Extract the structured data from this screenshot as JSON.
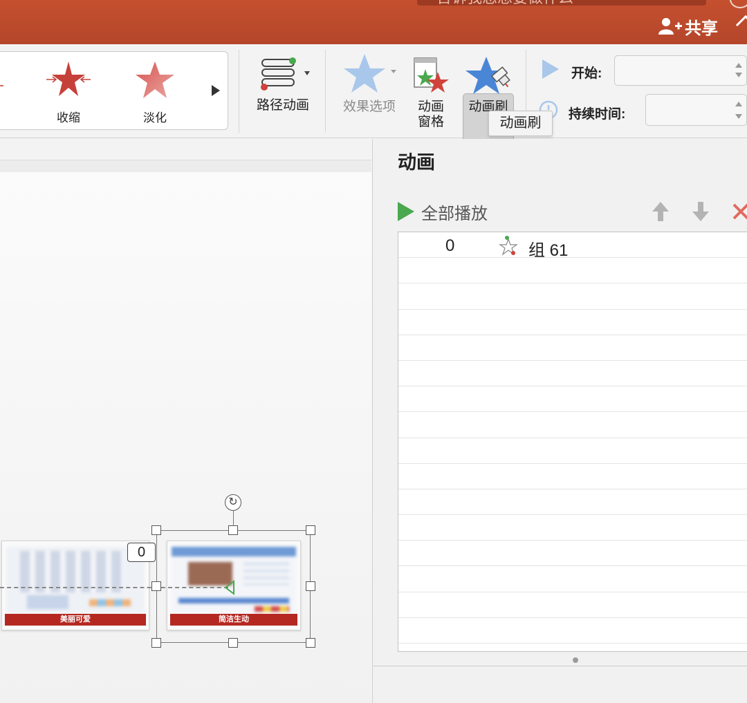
{
  "titlebar": {
    "search_text": "告诉我您想要做什么",
    "share_label": "共享",
    "colors": {
      "bar": "#b94a2c",
      "text": "#ffffff"
    }
  },
  "ribbon": {
    "gallery": [
      {
        "label": "收缩",
        "icon": "shrink-star-icon"
      },
      {
        "label": "淡化",
        "icon": "fade-star-icon"
      }
    ],
    "path_animation": "路径动画",
    "effect_options": "效果选项",
    "animation_pane_line1": "动画",
    "animation_pane_line2": "窗格",
    "animation_painter": "动画刷",
    "start_label": "开始:",
    "start_value": "",
    "duration_label": "持续时间:",
    "duration_value": "",
    "tooltip": "动画刷"
  },
  "slide": {
    "thumb1_caption": "美丽可爱",
    "thumb2_caption": "简洁生动",
    "animation_order_badge": "0"
  },
  "pane": {
    "title": "动画",
    "play_all": "全部播放",
    "items": [
      {
        "order": "0",
        "name": "组 61",
        "icon": "effect-star-icon"
      }
    ],
    "colors": {
      "play": "#4aa84e",
      "remove": "#e06b5e"
    }
  }
}
